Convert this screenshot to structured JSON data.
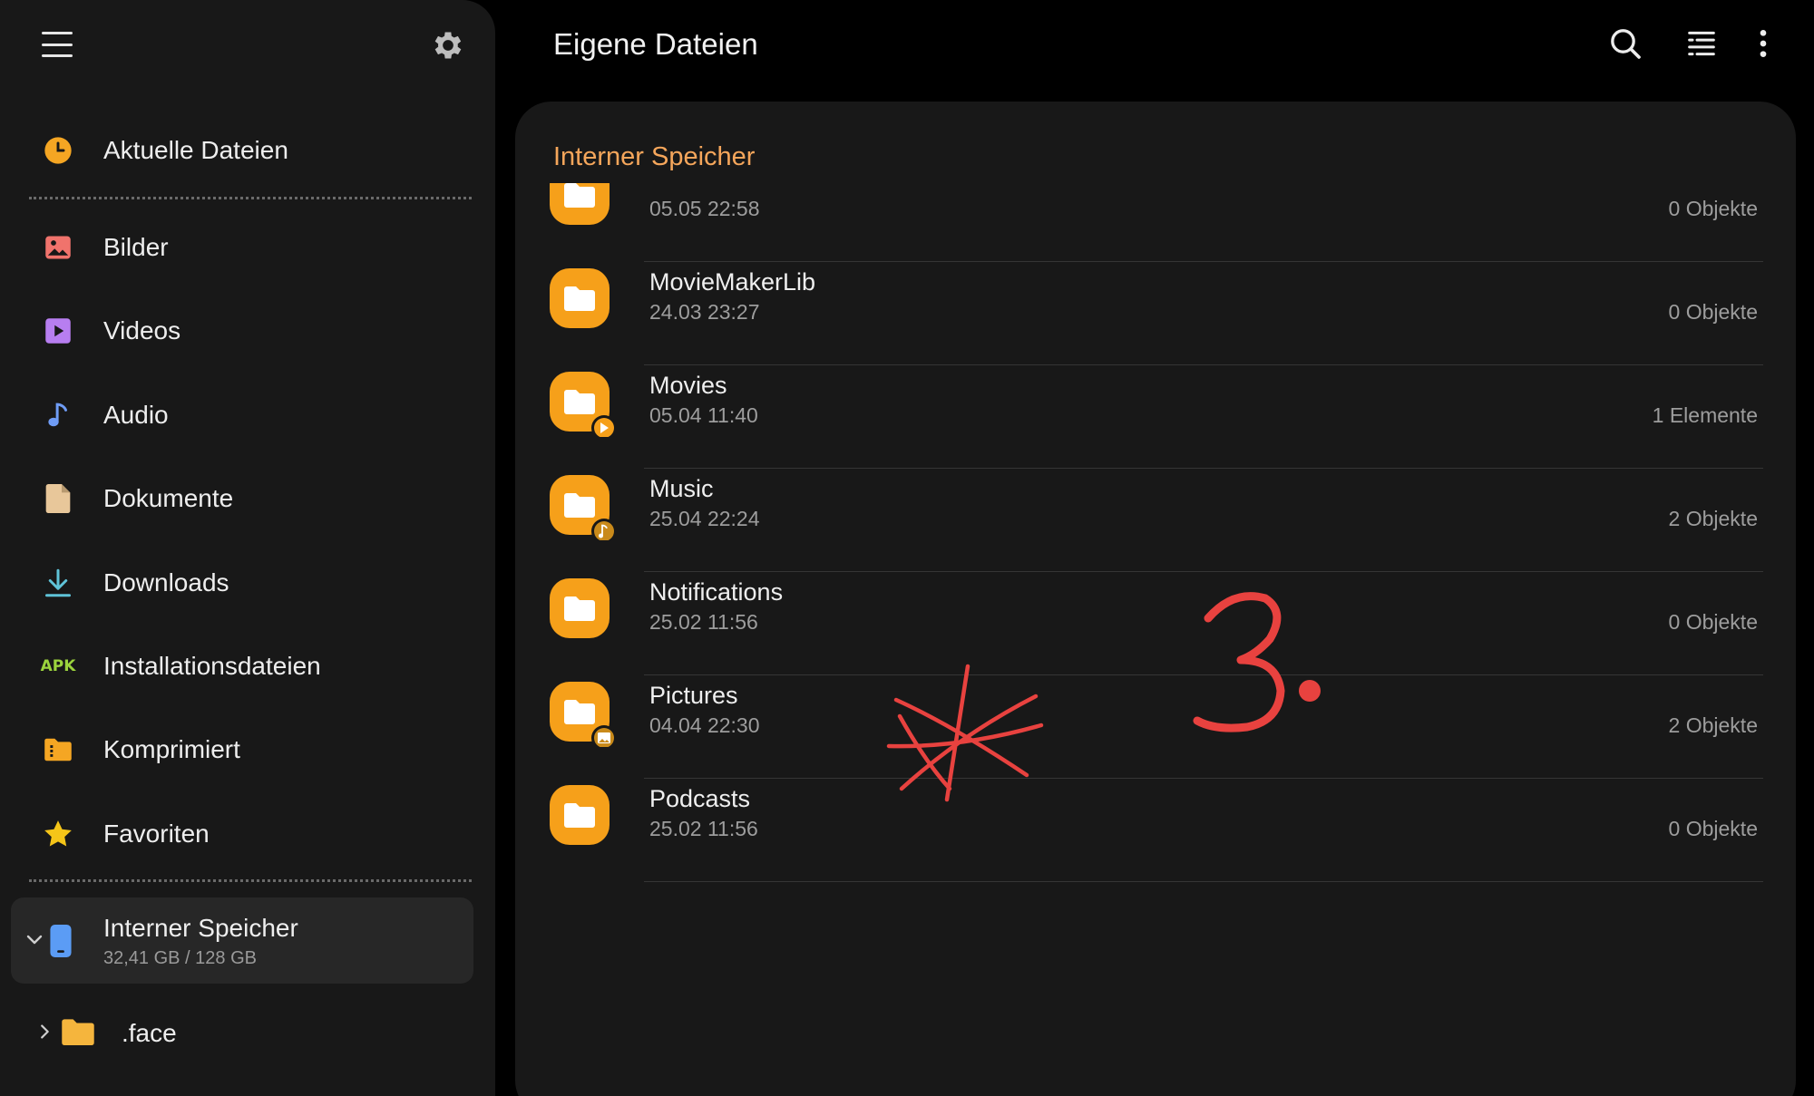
{
  "sidebar": {
    "nav": [
      {
        "label": "Aktuelle Dateien",
        "icon": "clock-icon",
        "color": "#f5a623"
      },
      {
        "label": "Bilder",
        "icon": "image-icon",
        "color": "#f0736c"
      },
      {
        "label": "Videos",
        "icon": "video-icon",
        "color": "#b77ef0"
      },
      {
        "label": "Audio",
        "icon": "music-note-icon",
        "color": "#6f9cf5"
      },
      {
        "label": "Dokumente",
        "icon": "document-icon",
        "color": "#e8c79a"
      },
      {
        "label": "Downloads",
        "icon": "download-icon",
        "color": "#5fc3d8"
      },
      {
        "label": "Installationsdateien",
        "icon": "apk-icon",
        "badge": "APK",
        "color": "#9bd33d"
      },
      {
        "label": "Komprimiert",
        "icon": "archive-icon",
        "color": "#f5a623"
      },
      {
        "label": "Favoriten",
        "icon": "star-icon",
        "color": "#f5c518"
      }
    ],
    "storage": {
      "title": "Interner Speicher",
      "usage": "32,41 GB / 128 GB",
      "color": "#5b9cf5"
    },
    "tree": [
      {
        "label": ".face"
      }
    ]
  },
  "header": {
    "title": "Eigene Dateien",
    "actions": [
      "search-icon",
      "sort-filter-icon",
      "more-vertical-icon"
    ]
  },
  "main": {
    "section_title": "Interner Speicher",
    "accent": "#f5a65b",
    "folder_color": "#f6a01a",
    "rows": [
      {
        "name": "",
        "date": "05.05 22:58",
        "count": "0 Objekte",
        "badge": ""
      },
      {
        "name": "MovieMakerLib",
        "date": "24.03 23:27",
        "count": "0 Objekte",
        "badge": ""
      },
      {
        "name": "Movies",
        "date": "05.04 11:40",
        "count": "1 Elemente",
        "badge": "play"
      },
      {
        "name": "Music",
        "date": "25.04 22:24",
        "count": "2 Objekte",
        "badge": "music"
      },
      {
        "name": "Notifications",
        "date": "25.02 11:56",
        "count": "0 Objekte",
        "badge": ""
      },
      {
        "name": "Pictures",
        "date": "04.04 22:30",
        "count": "2 Objekte",
        "badge": "image"
      },
      {
        "name": "Podcasts",
        "date": "25.02 11:56",
        "count": "0 Objekte",
        "badge": ""
      }
    ]
  },
  "annotation": {
    "color": "#e8423f",
    "text": "3."
  }
}
